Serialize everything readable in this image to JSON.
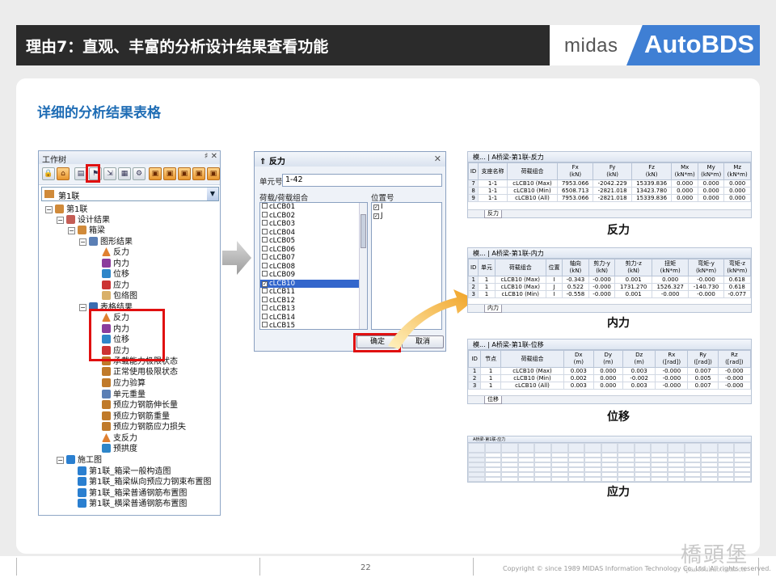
{
  "header": {
    "title": "理由7：直观、丰富的分析设计结果查看功能",
    "brand_midas": "midas",
    "brand_product": "AutoBDS"
  },
  "subtitle": "详细的分析结果表格",
  "tree": {
    "title": "工作树",
    "title_icons": "♯ ✕",
    "combo_value": "第1联",
    "items": [
      {
        "label": "第1联"
      },
      {
        "label": "设计结果"
      },
      {
        "label": "箱梁"
      },
      {
        "label": "图形结果"
      },
      {
        "label": "反力"
      },
      {
        "label": "内力"
      },
      {
        "label": "位移"
      },
      {
        "label": "应力"
      },
      {
        "label": "包络图"
      },
      {
        "label": "表格结果"
      },
      {
        "label": "反力"
      },
      {
        "label": "内力"
      },
      {
        "label": "位移"
      },
      {
        "label": "应力"
      },
      {
        "label": "承载能力极限状态"
      },
      {
        "label": "正常使用极限状态"
      },
      {
        "label": "应力验算"
      },
      {
        "label": "单元重量"
      },
      {
        "label": "预应力钢筋伸长量"
      },
      {
        "label": "预应力钢筋重量"
      },
      {
        "label": "预应力钢筋应力损失"
      },
      {
        "label": "支反力"
      },
      {
        "label": "预拱度"
      },
      {
        "label": "施工图"
      },
      {
        "label": "第1联_箱梁一般构造图"
      },
      {
        "label": "第1联_箱梁纵向预应力钢束布置图"
      },
      {
        "label": "第1联_箱梁普通钢筋布置图"
      },
      {
        "label": "第1联_横梁普通钢筋布置图"
      }
    ]
  },
  "dialog": {
    "title": "反力",
    "elem_label": "单元号",
    "elem_value": "1-42",
    "combo_header": "荷载/荷载组合",
    "pos_header": "位置号",
    "combos": [
      "cLCB01",
      "cLCB02",
      "cLCB03",
      "cLCB04",
      "cLCB05",
      "cLCB06",
      "cLCB07",
      "cLCB08",
      "cLCB09",
      "cLCB10",
      "cLCB11",
      "cLCB12",
      "cLCB13",
      "cLCB14",
      "cLCB15"
    ],
    "positions": [
      "I",
      "J"
    ],
    "ok": "确定",
    "cancel": "取消"
  },
  "reaction_table": {
    "tab": "A桥梁-第1联-反力",
    "prev_tab": "模...",
    "foot_tab": "反力",
    "caption": "反力",
    "headers": [
      "ID",
      "支座名称",
      "荷载组合",
      "Fx\n(kN)",
      "Fy\n(kN)",
      "Fz\n(kN)",
      "Mx\n(kN*m)",
      "My\n(kN*m)",
      "Mz\n(kN*m)"
    ],
    "rows": [
      [
        "7",
        "1-1",
        "cLCB10 (Max)",
        "7953.066",
        "-2042.229",
        "15339.836",
        "0.000",
        "0.000",
        "0.000"
      ],
      [
        "8",
        "1-1",
        "cLCB10 (Min)",
        "6508.713",
        "-2821.018",
        "13423.780",
        "0.000",
        "0.000",
        "0.000"
      ],
      [
        "9",
        "1-1",
        "cLCB10 (All)",
        "7953.066",
        "-2821.018",
        "15339.836",
        "0.000",
        "0.000",
        "0.000"
      ]
    ]
  },
  "force_table": {
    "tab": "A桥梁-第1联-内力",
    "prev_tab": "模...",
    "foot_tab": "内力",
    "caption": "内力",
    "headers": [
      "ID",
      "单元",
      "荷载组合",
      "位置",
      "轴向\n(kN)",
      "剪力-y\n(kN)",
      "剪力-z\n(kN)",
      "扭矩\n(kN*m)",
      "弯矩-y\n(kN*m)",
      "弯矩-z\n(kN*m)"
    ],
    "rows": [
      [
        "1",
        "1",
        "cLCB10 (Max)",
        "I",
        "-0.343",
        "-0.000",
        "0.001",
        "0.000",
        "-0.000",
        "0.618"
      ],
      [
        "2",
        "1",
        "cLCB10 (Max)",
        "J",
        "0.522",
        "-0.000",
        "1731.270",
        "1526.327",
        "-140.730",
        "0.618"
      ],
      [
        "3",
        "1",
        "cLCB10 (Min)",
        "I",
        "-0.558",
        "-0.000",
        "0.001",
        "-0.000",
        "-0.000",
        "-0.077"
      ]
    ]
  },
  "disp_table": {
    "tab": "A桥梁-第1联-位移",
    "prev_tab": "模...",
    "foot_tab": "位移",
    "caption": "位移",
    "headers": [
      "ID",
      "节点",
      "荷载组合",
      "Dx\n(m)",
      "Dy\n(m)",
      "Dz\n(m)",
      "Rx\n([rad])",
      "Ry\n([rad])",
      "Rz\n([rad])"
    ],
    "rows": [
      [
        "1",
        "1",
        "cLCB10 (Max)",
        "0.003",
        "0.000",
        "0.003",
        "-0.000",
        "0.007",
        "-0.000"
      ],
      [
        "2",
        "1",
        "cLCB10 (Min)",
        "0.002",
        "0.000",
        "-0.002",
        "-0.000",
        "0.005",
        "-0.000"
      ],
      [
        "3",
        "1",
        "cLCB10 (All)",
        "0.003",
        "0.000",
        "0.003",
        "-0.000",
        "0.007",
        "-0.000"
      ]
    ]
  },
  "stress_table": {
    "tab": "A桥梁-第1联-应力",
    "caption": "应力",
    "col_count": 17,
    "row_count": 6
  },
  "footer": {
    "page": "22",
    "copyright": "Copyright © since 1989 MIDAS Information Technology Co.,Ltd. All rights reserved.",
    "watermark": "橋頭堡",
    "watermark_url": "qiaotoubao.com.cn"
  }
}
